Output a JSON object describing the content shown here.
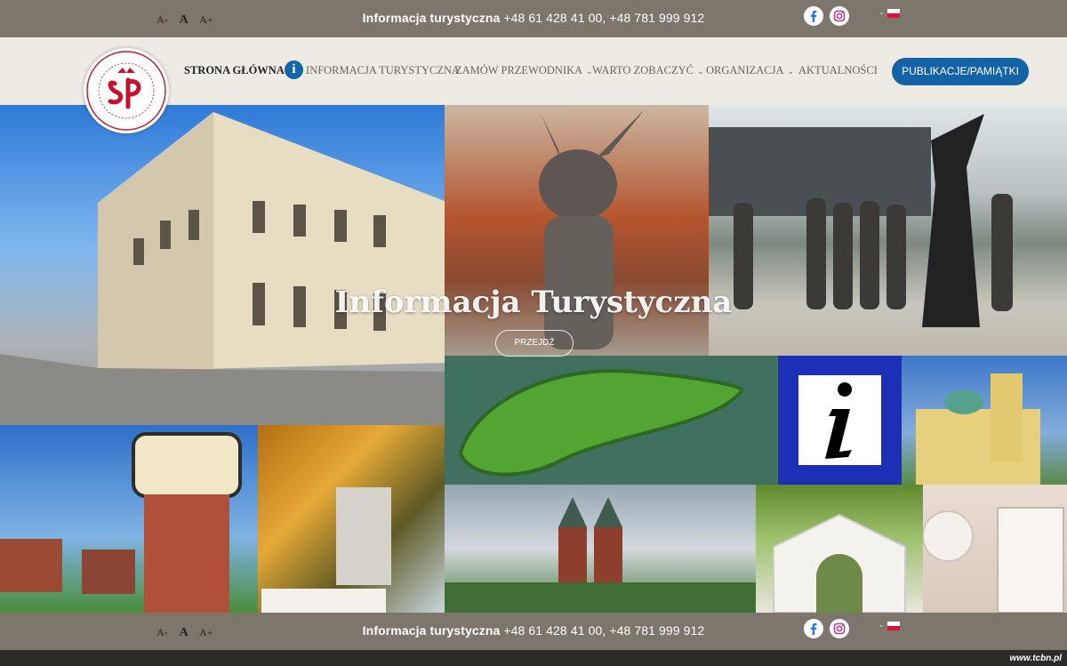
{
  "topbar": {
    "font_small": "A-",
    "font_normal": "A",
    "font_large": "A+",
    "contact_label": "Informacja turystyczna",
    "contact_phones": " +48 61 428 41 00, +48 781 999 912",
    "social_icons": [
      "facebook-icon",
      "instagram-icon"
    ],
    "language_arrow": "⌄"
  },
  "nav": {
    "items": [
      {
        "label": "STRONA GŁÓWNA"
      },
      {
        "label": "INFORMACJA TURYSTYCZNA"
      },
      {
        "label": "ZAMÓW PRZEWODNIKA"
      },
      {
        "label": "WARTO ZOBACZYĆ"
      },
      {
        "label": "ORGANIZACJA"
      },
      {
        "label": "AKTUALNOŚCI"
      }
    ],
    "chevron": "⌄",
    "info_icon_glyph": "i",
    "button": "PUBLIKACJE/PAMIĄTKI"
  },
  "hero": {
    "title": "Informacja Turystyczna",
    "button": "PRZEJDŹ"
  },
  "bottombar": {
    "font_small": "A-",
    "font_normal": "A",
    "font_large": "A+",
    "contact_label": "Informacja turystyczna",
    "contact_phones": " +48 61 428 41 00, +48 781 999 912"
  },
  "credit": "www.tcbn.pl",
  "colors": {
    "bar": "#7d766d",
    "nav_bg": "#eeeae4",
    "accent_blue": "#1363a6",
    "logo_red": "#c8102e",
    "info_sign_blue": "#1c2fb7"
  }
}
